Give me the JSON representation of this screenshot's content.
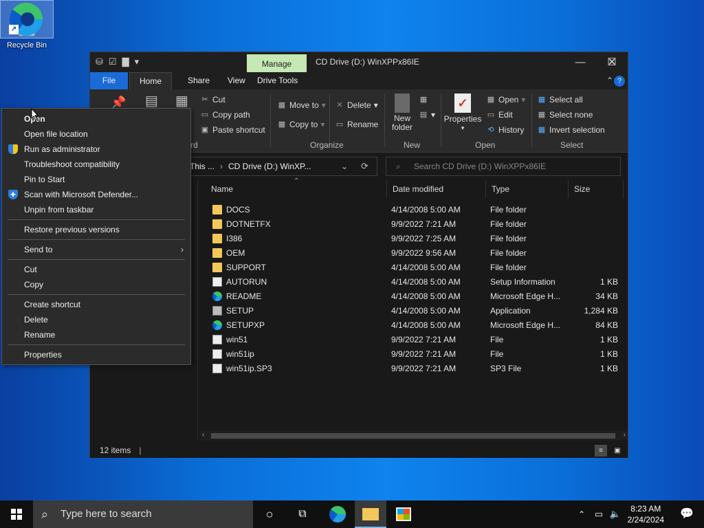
{
  "desktop": {
    "icons": [
      {
        "label": "Recycle Bin",
        "icon": "recycle-bin-icon"
      },
      {
        "label": "",
        "icon": "edge-icon"
      }
    ]
  },
  "explorer": {
    "title": "CD Drive (D:) WinXPPx86IE",
    "manage_tab": "Manage",
    "tabs": [
      "File",
      "Home",
      "Share",
      "View",
      "Drive Tools"
    ],
    "ribbon": {
      "clipboard": {
        "cut": "Cut",
        "copy_path": "Copy path",
        "paste_shortcut": "Paste shortcut",
        "label_fragment": "rd"
      },
      "organize": {
        "move_to": "Move to",
        "copy_to": "Copy to",
        "delete": "Delete",
        "rename": "Rename",
        "label": "Organize"
      },
      "new": {
        "new_folder": "New\nfolder",
        "label": "New"
      },
      "open": {
        "properties": "Properties",
        "open": "Open",
        "edit": "Edit",
        "history": "History",
        "label": "Open"
      },
      "select": {
        "select_all": "Select all",
        "select_none": "Select none",
        "invert": "Invert selection",
        "label": "Select"
      }
    },
    "address": {
      "prefix": "This ...",
      "path": "CD Drive (D:) WinXP..."
    },
    "search_placeholder": "Search CD Drive (D:) WinXPPx86IE",
    "columns": [
      "Name",
      "Date modified",
      "Type",
      "Size"
    ],
    "files": [
      {
        "name": "DOCS",
        "date": "4/14/2008 5:00 AM",
        "type": "File folder",
        "size": "",
        "icon": "folder"
      },
      {
        "name": "DOTNETFX",
        "date": "9/9/2022 7:21 AM",
        "type": "File folder",
        "size": "",
        "icon": "folder"
      },
      {
        "name": "I386",
        "date": "9/9/2022 7:25 AM",
        "type": "File folder",
        "size": "",
        "icon": "folder"
      },
      {
        "name": "OEM",
        "date": "9/9/2022 9:56 AM",
        "type": "File folder",
        "size": "",
        "icon": "folder"
      },
      {
        "name": "SUPPORT",
        "date": "4/14/2008 5:00 AM",
        "type": "File folder",
        "size": "",
        "icon": "folder"
      },
      {
        "name": "AUTORUN",
        "date": "4/14/2008 5:00 AM",
        "type": "Setup Information",
        "size": "1 KB",
        "icon": "doc"
      },
      {
        "name": "README",
        "date": "4/14/2008 5:00 AM",
        "type": "Microsoft Edge H...",
        "size": "34 KB",
        "icon": "edge"
      },
      {
        "name": "SETUP",
        "date": "4/14/2008 5:00 AM",
        "type": "Application",
        "size": "1,284 KB",
        "icon": "app"
      },
      {
        "name": "SETUPXP",
        "date": "4/14/2008 5:00 AM",
        "type": "Microsoft Edge H...",
        "size": "84 KB",
        "icon": "edge"
      },
      {
        "name": "win51",
        "date": "9/9/2022 7:21 AM",
        "type": "File",
        "size": "1 KB",
        "icon": "doc"
      },
      {
        "name": "win51ip",
        "date": "9/9/2022 7:21 AM",
        "type": "File",
        "size": "1 KB",
        "icon": "doc"
      },
      {
        "name": "win51ip.SP3",
        "date": "9/9/2022 7:21 AM",
        "type": "SP3 File",
        "size": "1 KB",
        "icon": "doc"
      }
    ],
    "status": "12 items"
  },
  "context_menu": {
    "items": [
      {
        "label": "Open",
        "icon": ""
      },
      {
        "label": "Open file location",
        "icon": ""
      },
      {
        "label": "Run as administrator",
        "icon": "shield-icon"
      },
      {
        "label": "Troubleshoot compatibility",
        "icon": ""
      },
      {
        "label": "Pin to Start",
        "icon": ""
      },
      {
        "label": "Scan with Microsoft Defender...",
        "icon": "defender-icon"
      },
      {
        "label": "Unpin from taskbar",
        "icon": ""
      },
      {
        "label": "Restore previous versions",
        "icon": ""
      },
      {
        "label": "Send to",
        "icon": ""
      },
      {
        "label": "Cut",
        "icon": ""
      },
      {
        "label": "Copy",
        "icon": ""
      },
      {
        "label": "Create shortcut",
        "icon": ""
      },
      {
        "label": "Delete",
        "icon": ""
      },
      {
        "label": "Rename",
        "icon": ""
      },
      {
        "label": "Properties",
        "icon": ""
      }
    ]
  },
  "taskbar": {
    "search_placeholder": "Type here to search",
    "time": "8:23 AM",
    "date": "2/24/2024"
  }
}
